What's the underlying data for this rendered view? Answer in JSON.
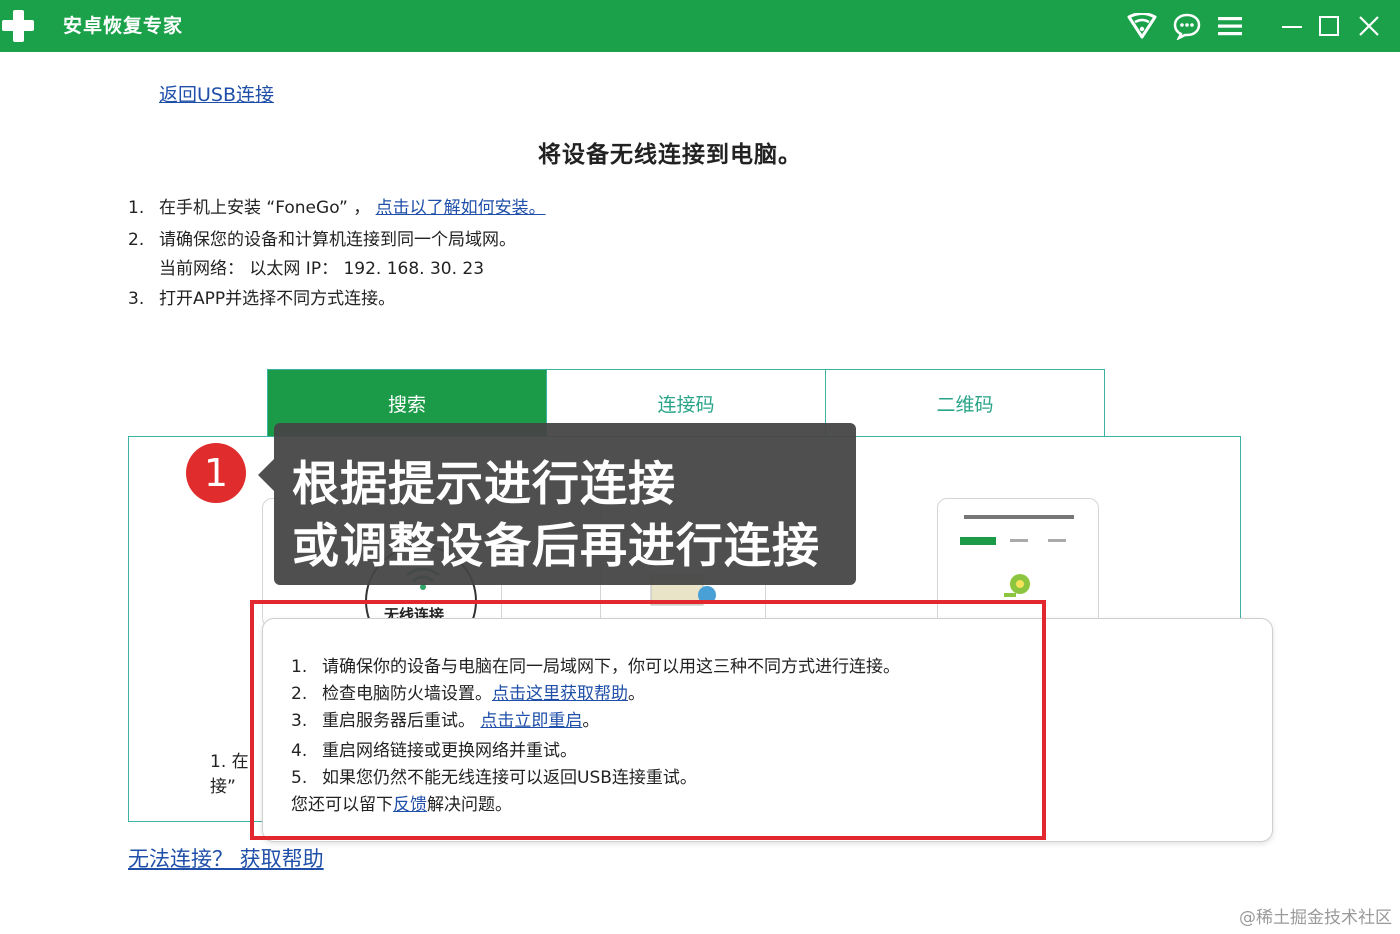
{
  "titlebar": {
    "title": "安卓恢复专家",
    "icons": [
      "app-plus-logo",
      "wifi-icon",
      "chat-icon",
      "menu-icon",
      "minimize-icon",
      "maximize-icon",
      "close-icon"
    ],
    "accent_color": "#1aa14a"
  },
  "back_link": "返回USB连接",
  "heading": "将设备无线连接到电脑。",
  "steps": {
    "s1_num": "1.",
    "s1_text": "在手机上安装 “FoneGo” ，",
    "s1_link": "点击以了解如何安装。",
    "s2_num": "2.",
    "s2_text": "请确保您的设备和计算机连接到同一个局域网。",
    "s2_network": "当前网络：   以太网      IP：   192. 168. 30. 23",
    "s3_num": "3.",
    "s3_text": "打开APP并选择不同方式连接。"
  },
  "tabs": [
    {
      "label": "搜索",
      "active": true
    },
    {
      "label": "连接码",
      "active": false
    },
    {
      "label": "二维码",
      "active": false
    }
  ],
  "panel": {
    "wifi_label": "无线连接",
    "partial_step_line1": "1.  在",
    "partial_step_line2": "接”"
  },
  "callout": {
    "badge": "1",
    "line1": "根据提示进行连接",
    "line2": "或调整设备后再进行连接"
  },
  "help_dialog": {
    "i1_num": "1.",
    "i1_text": "请确保你的设备与电脑在同一局域网下，你可以用这三种不同方式进行连接。",
    "i2_num": "2.",
    "i2_text": "检查电脑防火墙设置。",
    "i2_link": "点击这里获取帮助",
    "i2_end": "。",
    "i3_num": "3.",
    "i3_text": "重启服务器后重试。 ",
    "i3_link": "点击立即重启",
    "i3_end": "。",
    "i4_num": "4.",
    "i4_text": "重启网络链接或更换网络并重试。",
    "i5_num": "5.",
    "i5_text": "如果您仍然不能无线连接可以返回USB连接重试。",
    "footer_pre": "您还可以留下",
    "footer_link": "反馈",
    "footer_post": "解决问题。"
  },
  "help_footer_link": "无法连接？ 获取帮助",
  "watermark": "@稀土掘金技术社区",
  "highlight_color": "#e0282e"
}
